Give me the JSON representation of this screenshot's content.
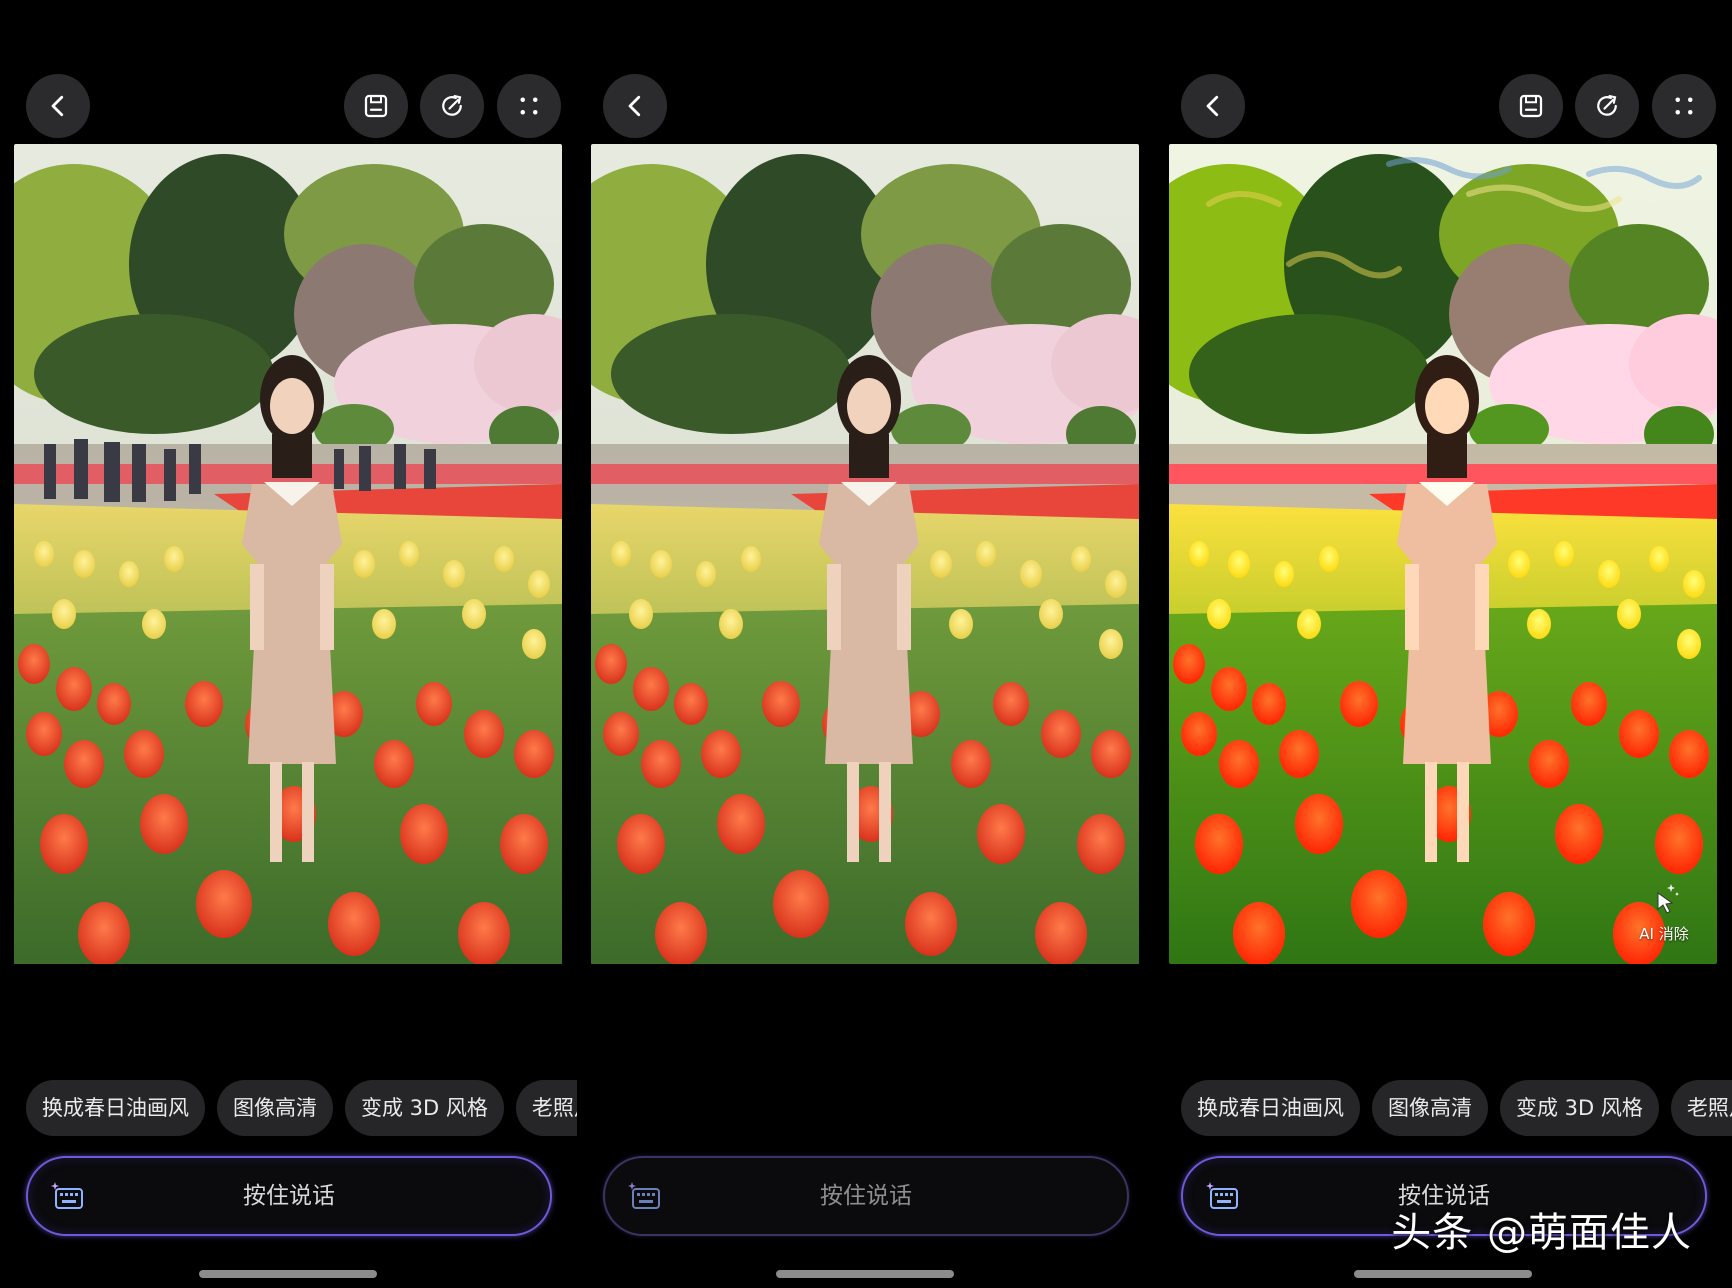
{
  "panels": [
    {
      "chips": [
        "换成春日油画风",
        "图像高清",
        "变成 3D 风格",
        "老照片修复"
      ],
      "voice_label": "按住说话"
    },
    {
      "chips": [],
      "voice_label": "按住说话"
    },
    {
      "chips": [
        "换成春日油画风",
        "图像高清",
        "变成 3D 风格",
        "老照片修复"
      ],
      "voice_label": "按住说话",
      "ai_erase_label": "AI 消除"
    }
  ],
  "watermark": "头条 @萌面佳人",
  "icons": [
    "chevron-left-icon",
    "save-icon",
    "edit-refresh-icon",
    "scan-icon",
    "keyboard-sparkle-icon",
    "ai-erase-icon"
  ]
}
